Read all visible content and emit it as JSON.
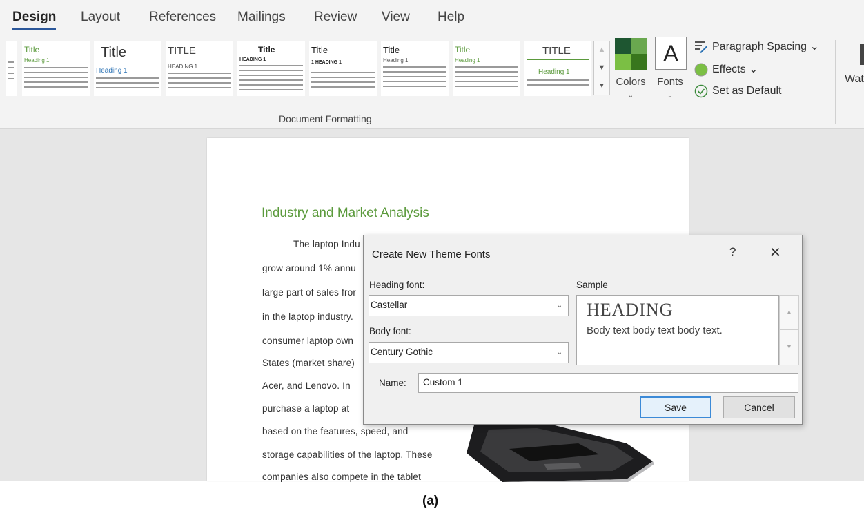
{
  "ribbon": {
    "tabs": [
      "Design",
      "Layout",
      "References",
      "Mailings",
      "Review",
      "View",
      "Help"
    ],
    "active_tab": "Design",
    "gallery": [
      {
        "title": "Title",
        "heading": "Heading 1"
      },
      {
        "title": "Title",
        "heading": "Heading 1"
      },
      {
        "title": "TITLE",
        "heading": "HEADING 1"
      },
      {
        "title": "Title",
        "heading": "HEADING 1"
      },
      {
        "title": "Title",
        "heading": "1 HEADING 1"
      },
      {
        "title": "Title",
        "heading": "Heading 1"
      },
      {
        "title": "Title",
        "heading": "Heading 1"
      },
      {
        "title": "TITLE",
        "heading": "Heading 1"
      }
    ],
    "group_label": "Document Formatting",
    "colors_label": "Colors",
    "fonts_label": "Fonts",
    "fonts_glyph": "A",
    "paragraph_spacing": "Paragraph Spacing",
    "effects": "Effects",
    "set_default": "Set as Default",
    "watermark_partial": "Wat",
    "colors": {
      "accent": "#2b579a",
      "title_green": "#5b9a3c"
    }
  },
  "document": {
    "heading": "Industry and Market Analysis",
    "lines": [
      "The laptop Indu",
      "grow around 1% annu",
      "large part of sales fror",
      "in the laptop industry.",
      "consumer laptop own",
      "States (market share)",
      "Acer, and Lenovo.  In",
      "purchase a laptop at",
      "based on the features, speed, and",
      "storage capabilities of the laptop. These",
      "companies also compete in the tablet"
    ]
  },
  "dialog": {
    "title": "Create New Theme Fonts",
    "help": "?",
    "close": "✕",
    "heading_font_label": "Heading font:",
    "heading_font_value": "Castellar",
    "body_font_label": "Body font:",
    "body_font_value": "Century Gothic",
    "sample_label": "Sample",
    "sample_heading": "HEADING",
    "sample_body": "Body text body text body text.",
    "name_label": "Name:",
    "name_value": "Custom 1",
    "save": "Save",
    "cancel": "Cancel"
  },
  "caption": "(a)"
}
